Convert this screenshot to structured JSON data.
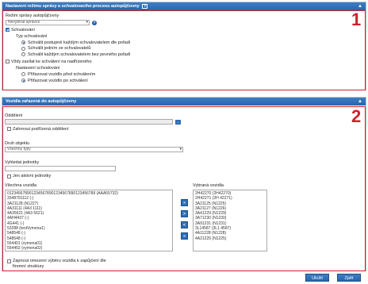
{
  "section1": {
    "header": "Nastavení režimu správy a schvalovacího procesu autopůjčovny",
    "help_glyph": "?",
    "collapse_glyph": "▲",
    "number": "1",
    "mode_label": "Režim správy autopůjčovny",
    "mode_value": "Nevybírat správce",
    "approval_checkbox": "Schvalování",
    "approval_checked": true,
    "approval_type_label": "Typ schvalování",
    "options": [
      {
        "label": "Schválit postupně každým schvalovatelem dle pořadí",
        "checked": true
      },
      {
        "label": "Schválit jedním ze schvalovatelů",
        "checked": false
      },
      {
        "label": "Schválit každým schvalovatelem bez pevného pořadí",
        "checked": false
      }
    ],
    "superior_checkbox": "Vždy zasílat ke schválení na nadřízeného",
    "superior_checked": false,
    "settings_label": "Nastavení schvalování",
    "assign_options": [
      {
        "label": "Přiřazovat vozidlo před schválením",
        "checked": false
      },
      {
        "label": "Přiřazovat vozidlo po schválení",
        "checked": true
      }
    ]
  },
  "section2": {
    "header": "Vozidla zařazená do autopůjčovny",
    "collapse_glyph": "▲",
    "number": "2",
    "department_label": "Oddělení",
    "dots": "...",
    "include_sub": "Zahrnout podřízená oddělení",
    "object_type_label": "Druh objektu",
    "object_type_value": "Všechny typy",
    "search_label": "Vyhledat jednotky",
    "active_only": "Jen aktivní jednotky",
    "all_vehicles_label": "Všechna vozidla",
    "selected_vehicles_label": "Vybraná vozidla",
    "all_vehicles": [
      "0123456789012345678901234567890123456789 (AAA55732)",
      "3348791112 (-)",
      "3A21128 (N1227)",
      "4A31111 (4A3 1111)",
      "4A35621 (4A3 5621)",
      "4AH4437 (-)",
      "4G441 (-)",
      "53288 (testVymena1)",
      "548548 (-)",
      "548548 (-)",
      "554401 (vymena01)",
      "554402 (vymena02)"
    ],
    "selected_vehicles": [
      "2H42270 (2H42270)",
      "2H42271 (2H 42271)",
      "3A21125 (N1225)",
      "3A21127 (N1226)",
      "3A41229 (N1229)",
      "3A71230 (N1230)",
      "3A91231 (N1231)",
      "3L14587 (3L1 4587)",
      "4A11228 (N1228)",
      "4A21225 (N1225)"
    ],
    "arrows": [
      "»",
      ">",
      "<",
      "«"
    ],
    "limit_checkbox": "Zapnout omezení výběru vozidla k zapůjčení dle firemní struktury"
  },
  "footer": {
    "save": "Uložit",
    "back": "Zpět"
  }
}
